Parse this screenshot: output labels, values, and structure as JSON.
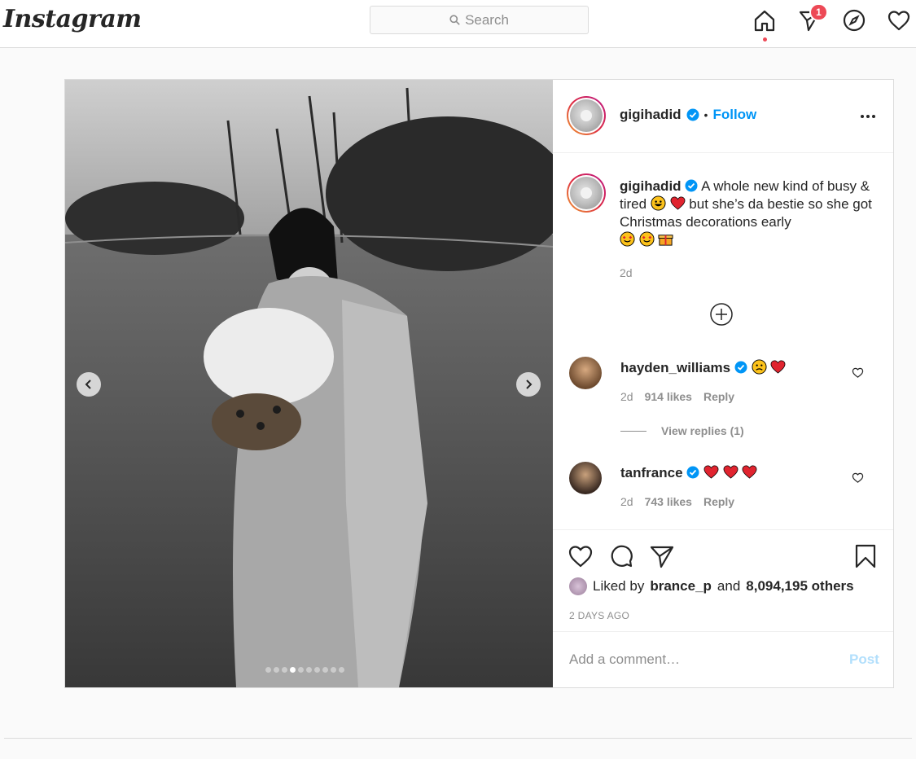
{
  "app": {
    "logo_text": "Instagram"
  },
  "search": {
    "placeholder": "Search"
  },
  "nav": {
    "icons": [
      "home-icon",
      "direct-message-icon",
      "explore-compass-icon",
      "activity-heart-icon"
    ],
    "messages_badge": "1"
  },
  "post": {
    "author": "gigihadid",
    "follow_label": "Follow",
    "separator": "•",
    "caption": {
      "part1": "A whole new kind of busy & tired",
      "part2": "but she’s da bestie so she got Christmas decorations early"
    },
    "caption_age": "2d",
    "carousel": {
      "count": 10,
      "active_index": 3
    },
    "comments": [
      {
        "username": "hayden_williams",
        "verified": true,
        "age": "2d",
        "likes": "914 likes",
        "reply_label": "Reply",
        "emoji": [
          "sad-face",
          "red-heart"
        ]
      },
      {
        "username": "tanfrance",
        "verified": true,
        "age": "2d",
        "likes": "743 likes",
        "reply_label": "Reply",
        "emoji": [
          "red-heart",
          "red-heart",
          "red-heart"
        ]
      }
    ],
    "view_replies_label": "View replies (1)",
    "liked_by": {
      "prefix": "Liked by",
      "user": "brance_p",
      "connector": "and",
      "count": "8,094,195 others"
    },
    "time_ago": "2 DAYS AGO",
    "add_comment_placeholder": "Add a comment…",
    "post_button_label": "Post"
  },
  "colors": {
    "accent": "#0095f6",
    "notification": "#ed4956",
    "post_disabled": "#b2dffc",
    "border": "#dbdbdb",
    "muted": "#8e8e8e"
  }
}
